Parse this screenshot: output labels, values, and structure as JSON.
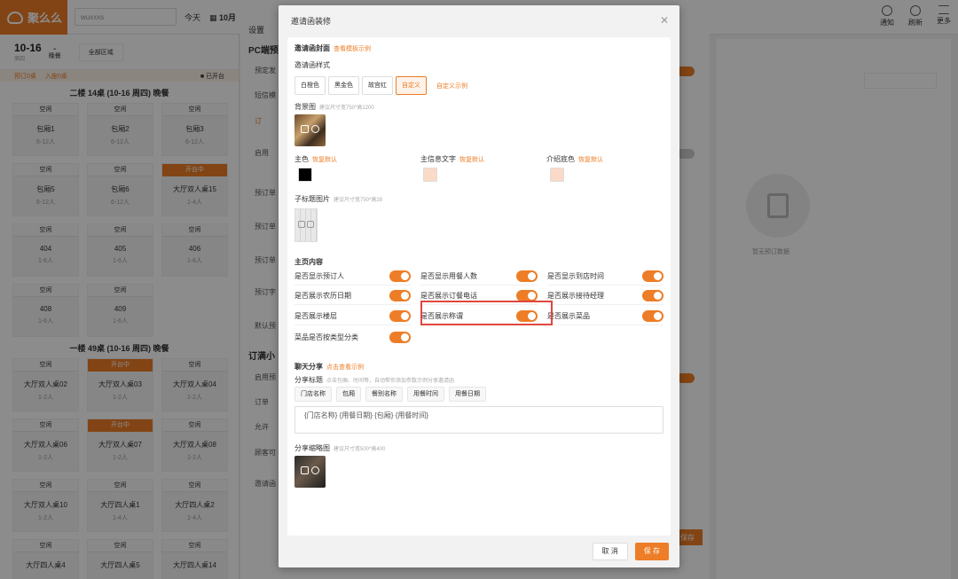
{
  "app": {
    "logo_text": "聚么么",
    "store": "wuxxxs",
    "today_label": "今天",
    "date_label": "10月",
    "top_icons": [
      {
        "label": "通知",
        "icon": "bell-icon"
      },
      {
        "label": "刷新",
        "icon": "refresh-icon"
      },
      {
        "label": "更多",
        "icon": "menu-icon"
      }
    ]
  },
  "left_panel": {
    "date": "10-16",
    "weekday": "周四",
    "meal": "晚餐",
    "area_button": "全部区域",
    "legend_left": "预订0桌",
    "legend_mid": "入座0桌",
    "legend_right": "已开台",
    "floors": [
      {
        "title": "二楼 14桌 (10-16 周四) 晚餐",
        "tables": [
          {
            "status": "空闲",
            "name": "包厢1",
            "cap": "6-12人",
            "busy": false
          },
          {
            "status": "空闲",
            "name": "包厢2",
            "cap": "6-12人",
            "busy": false
          },
          {
            "status": "空闲",
            "name": "包厢3",
            "cap": "6-12人",
            "busy": false
          },
          {
            "status": "空闲",
            "name": "包厢5",
            "cap": "6-12人",
            "busy": false
          },
          {
            "status": "空闲",
            "name": "包厢6",
            "cap": "6-12人",
            "busy": false
          },
          {
            "status": "开台中",
            "name": "大厅双人桌15",
            "cap": "1-4人",
            "busy": true
          },
          {
            "status": "空闲",
            "name": "404",
            "cap": "1-6人",
            "busy": false
          },
          {
            "status": "空闲",
            "name": "405",
            "cap": "1-6人",
            "busy": false
          },
          {
            "status": "空闲",
            "name": "406",
            "cap": "1-6人",
            "busy": false
          },
          {
            "status": "空闲",
            "name": "408",
            "cap": "1-6人",
            "busy": false
          },
          {
            "status": "空闲",
            "name": "409",
            "cap": "1-6人",
            "busy": false
          }
        ]
      },
      {
        "title": "一楼 49桌 (10-16 周四) 晚餐",
        "tables": [
          {
            "status": "空闲",
            "name": "大厅双人桌02",
            "cap": "1-2人",
            "busy": false
          },
          {
            "status": "开台中",
            "name": "大厅双人桌03",
            "cap": "1-2人",
            "busy": true
          },
          {
            "status": "空闲",
            "name": "大厅双人桌04",
            "cap": "1-2人",
            "busy": false
          },
          {
            "status": "空闲",
            "name": "大厅双人桌06",
            "cap": "1-2人",
            "busy": false
          },
          {
            "status": "开台中",
            "name": "大厅双人桌07",
            "cap": "1-2人",
            "busy": true
          },
          {
            "status": "空闲",
            "name": "大厅双人桌08",
            "cap": "1-2人",
            "busy": false
          },
          {
            "status": "空闲",
            "name": "大厅双人桌10",
            "cap": "1-2人",
            "busy": false
          },
          {
            "status": "空闲",
            "name": "大厅四人桌1",
            "cap": "1-4人",
            "busy": false
          },
          {
            "status": "空闲",
            "name": "大厅四人桌2",
            "cap": "1-4人",
            "busy": false
          },
          {
            "status": "空闲",
            "name": "大厅四人桌4",
            "cap": "",
            "busy": false
          },
          {
            "status": "空闲",
            "name": "大厅四人桌5",
            "cap": "",
            "busy": false
          },
          {
            "status": "空闲",
            "name": "大厅四人桌14",
            "cap": "",
            "busy": false
          }
        ]
      }
    ]
  },
  "settings_panel": {
    "title": "设置",
    "pc_section": "PC端预",
    "rows_a": [
      "预定发",
      "短信模",
      "订"
    ],
    "rows_b": [
      "启用",
      "预订单",
      "预订单",
      "预订单",
      "预订字",
      "默认预"
    ],
    "mini_section": "订满小",
    "rows_c": [
      "启用预",
      "订单",
      "允许",
      "顾客可",
      "邀请函"
    ],
    "save": "保存"
  },
  "right_panel": {
    "search_placeholder": "",
    "empty_text": "暂无预订数据"
  },
  "modal": {
    "title": "邀请函装修",
    "cover_section": "邀请函封面",
    "cover_example": "查看模板示例",
    "style_label": "邀请函样式",
    "styles": [
      "白橙色",
      "黑金色",
      "故宫红",
      "自定义"
    ],
    "active_style": "自定义",
    "custom_example": "自定义示例",
    "bg_label": "背景图",
    "bg_hint": "建议尺寸宽750*高1200",
    "main_color_label": "主色",
    "main_color_reset": "恢复默认",
    "main_color": "#000000",
    "text_color_label": "主信息文字",
    "text_color_reset": "恢复默认",
    "text_color": "#fbdac8",
    "intro_color_label": "介绍底色",
    "intro_color_reset": "恢复默认",
    "intro_color": "#fbdac8",
    "subtitle_img_label": "子标题图片",
    "subtitle_img_hint": "建议尺寸宽750*高28",
    "content_section": "主页内容",
    "toggles": [
      "是否显示预订人",
      "是否显示用餐人数",
      "是否显示到店时间",
      "是否展示农历日期",
      "是否展示订餐电话",
      "是否展示接待经理",
      "是否展示楼层",
      "是否展示称谓",
      "是否展示菜品",
      "菜品是否按类型分类"
    ],
    "share_section": "聊天分享",
    "share_example": "点击查看示例",
    "share_title_label": "分享标题",
    "share_title_hint": "点击包厢、时间等，自动帮你添加参数示例分享邀请函",
    "share_tags": [
      "门店名称",
      "包厢",
      "餐别名称",
      "用餐时间",
      "用餐日期"
    ],
    "share_input_value": "{门店名称} {用餐日期} {包厢} {用餐时间}",
    "share_thumb_label": "分享缩略图",
    "share_thumb_hint": "建议尺寸宽500*高400",
    "cancel": "取 消",
    "save": "保 存",
    "accent": "#ed7d26"
  }
}
